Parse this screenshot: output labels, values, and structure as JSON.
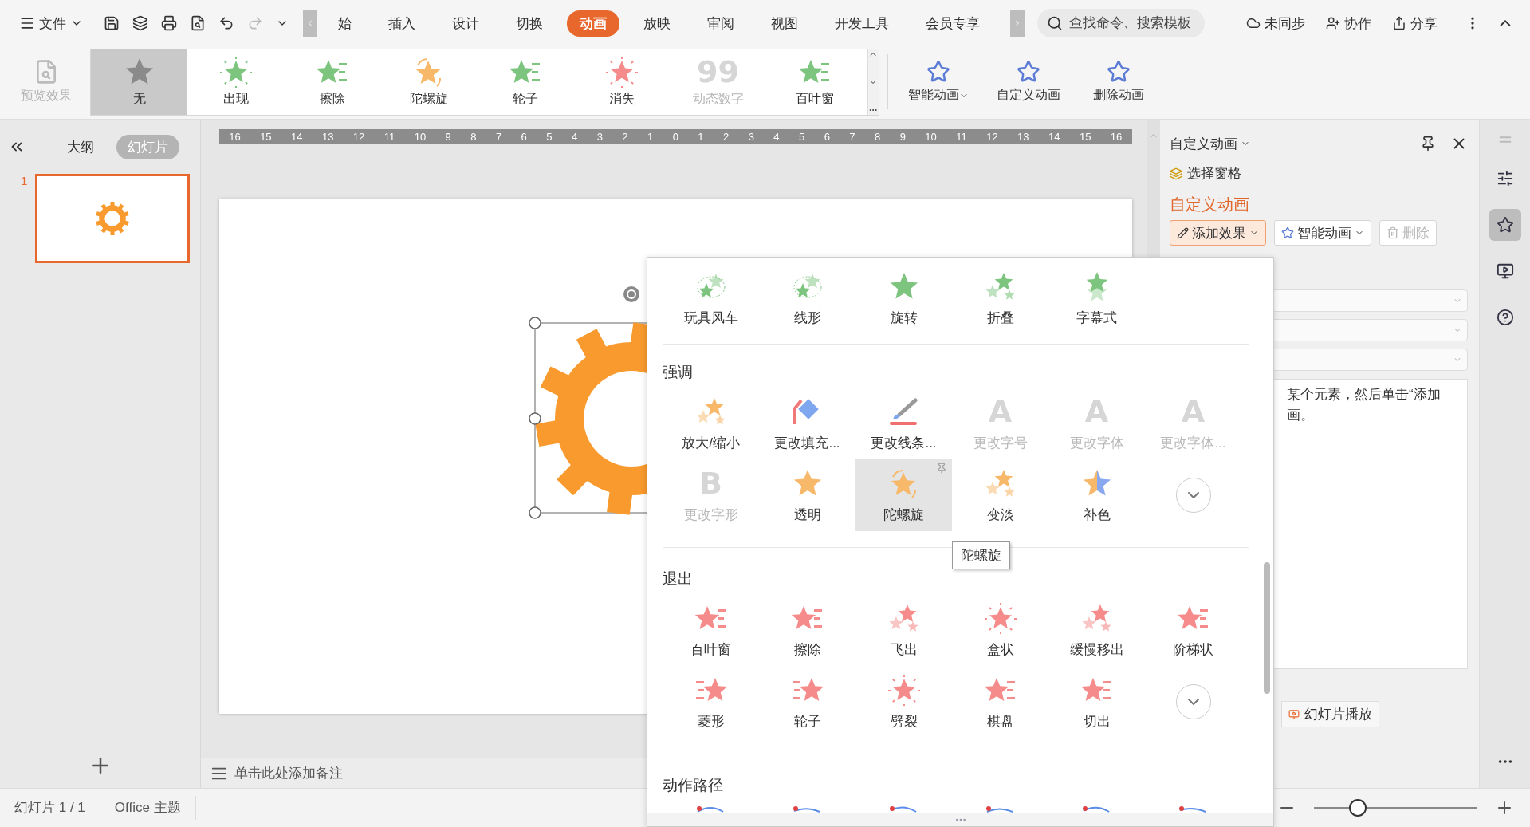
{
  "menu_bar": {
    "file_menu": "文件",
    "tabs": [
      {
        "label": "始",
        "selected": false
      },
      {
        "label": "插入",
        "selected": false
      },
      {
        "label": "设计",
        "selected": false
      },
      {
        "label": "切换",
        "selected": false
      },
      {
        "label": "动画",
        "selected": true
      },
      {
        "label": "放映",
        "selected": false
      },
      {
        "label": "审阅",
        "selected": false
      },
      {
        "label": "视图",
        "selected": false
      },
      {
        "label": "开发工具",
        "selected": false
      },
      {
        "label": "会员专享",
        "selected": false
      }
    ],
    "search": {
      "placeholder": "查找命令、搜索模板"
    },
    "actions": [
      "未同步",
      "协作",
      "分享"
    ]
  },
  "ribbon": {
    "preview": {
      "label": "预览效果",
      "disabled": true
    },
    "gallery": [
      {
        "label": "无",
        "kind": "star",
        "color": "#8a8a8a",
        "selected": true,
        "disabled": false
      },
      {
        "label": "出现",
        "kind": "burst",
        "color": "#7dc47f",
        "selected": false,
        "disabled": false
      },
      {
        "label": "擦除",
        "kind": "lines",
        "color": "#7dc47f",
        "selected": false,
        "disabled": false
      },
      {
        "label": "陀螺旋",
        "kind": "spin",
        "color": "#f8b86a",
        "selected": false,
        "disabled": false
      },
      {
        "label": "轮子",
        "kind": "lines",
        "color": "#7dc47f",
        "selected": false,
        "disabled": false
      },
      {
        "label": "消失",
        "kind": "burst",
        "color": "#f58b8b",
        "selected": false,
        "disabled": false
      },
      {
        "label": "动态数字",
        "kind": "letter",
        "glyph": "99",
        "color": "#d6d6d6",
        "selected": false,
        "disabled": true
      },
      {
        "label": "百叶窗",
        "kind": "lines",
        "color": "#7dc47f",
        "selected": false,
        "disabled": false
      }
    ],
    "buttons": [
      {
        "label": "智能动画",
        "dropdown": true
      },
      {
        "label": "自定义动画"
      },
      {
        "label": "删除动画"
      }
    ]
  },
  "ruler": {
    "labels": [
      "16",
      "15",
      "14",
      "13",
      "12",
      "11",
      "10",
      "9",
      "8",
      "7",
      "6",
      "5",
      "4",
      "3",
      "2",
      "1",
      "0",
      "1",
      "2",
      "3",
      "4",
      "5",
      "6",
      "7",
      "8",
      "9",
      "10",
      "11",
      "12",
      "13",
      "14",
      "15",
      "16"
    ]
  },
  "outline_panel": {
    "tabs": [
      {
        "label": "大纲",
        "selected": false
      },
      {
        "label": "幻灯片",
        "selected": true
      }
    ],
    "slides": [
      {
        "number": "1",
        "selected": true
      }
    ]
  },
  "notes": {
    "placeholder": "单击此处添加备注"
  },
  "task_pane": {
    "title": "自定义动画",
    "selection_pane": "选择窗格",
    "heading": "自定义动画",
    "buttons": [
      {
        "label": "添加效果",
        "dropdown": true,
        "active": true,
        "disabled": false
      },
      {
        "label": "智能动画",
        "dropdown": true,
        "active": false,
        "disabled": false
      },
      {
        "label": "删除",
        "active": false,
        "disabled": true
      }
    ],
    "hint_lines": [
      "某个元素，然后单击“添加",
      "画。"
    ],
    "play_button": "幻灯片播放"
  },
  "status_bar": {
    "items": [
      "幻灯片 1 / 1",
      "Office 主题"
    ],
    "zoom": {
      "level": 0.27
    }
  },
  "effects_menu": {
    "tooltip": "陀螺旋",
    "sections": [
      {
        "kind": "grid",
        "items": [
          {
            "label": "玩具风车",
            "kind": "orbit",
            "color": "#7dc47f",
            "selected": false,
            "disabled": false
          },
          {
            "label": "线形",
            "kind": "orbit",
            "color": "#7dc47f",
            "selected": false,
            "disabled": false
          },
          {
            "label": "旋转",
            "kind": "star",
            "color": "#7dc47f",
            "selected": false,
            "disabled": false
          },
          {
            "label": "折叠",
            "kind": "pair",
            "color": "#7dc47f",
            "selected": false,
            "disabled": false
          },
          {
            "label": "字幕式",
            "kind": "stack",
            "color": "#7dc47f",
            "selected": false,
            "disabled": false
          }
        ]
      },
      {
        "kind": "grid",
        "title": "强调",
        "more": true,
        "items": [
          {
            "label": "放大/缩小",
            "kind": "pair",
            "color": "#f8b86a",
            "selected": false,
            "disabled": false
          },
          {
            "label": "更改填充...",
            "kind": "fill",
            "color": "#7fa7ef",
            "selected": false,
            "disabled": false
          },
          {
            "label": "更改线条...",
            "kind": "pen",
            "color": "#f07070",
            "selected": false,
            "disabled": false
          },
          {
            "label": "更改字号",
            "kind": "letter",
            "glyph": "A",
            "color": "#d6d6d6",
            "selected": false,
            "disabled": true
          },
          {
            "label": "更改字体",
            "kind": "letter",
            "glyph": "A",
            "color": "#d6d6d6",
            "selected": false,
            "disabled": true
          },
          {
            "label": "更改字体...",
            "kind": "letter",
            "glyph": "A",
            "color": "#d6d6d6",
            "selected": false,
            "disabled": true
          },
          {
            "label": "更改字形",
            "kind": "letter",
            "glyph": "B",
            "color": "#d6d6d6",
            "selected": false,
            "disabled": true
          },
          {
            "label": "透明",
            "kind": "star",
            "color": "#f8b86a",
            "selected": false,
            "disabled": false
          },
          {
            "label": "陀螺旋",
            "kind": "spin",
            "color": "#f8b86a",
            "selected": true,
            "disabled": false
          },
          {
            "label": "变淡",
            "kind": "pair",
            "color": "#f8b86a",
            "selected": false,
            "disabled": false
          },
          {
            "label": "补色",
            "kind": "bicolor",
            "color": "#f8b86a",
            "selected": false,
            "disabled": false
          }
        ]
      },
      {
        "kind": "grid",
        "title": "退出",
        "more": true,
        "items": [
          {
            "label": "百叶窗",
            "kind": "lines",
            "color": "#f58b8b",
            "selected": false,
            "disabled": false
          },
          {
            "label": "擦除",
            "kind": "lines",
            "color": "#f58b8b",
            "selected": false,
            "disabled": false
          },
          {
            "label": "飞出",
            "kind": "pair",
            "color": "#f58b8b",
            "selected": false,
            "disabled": false
          },
          {
            "label": "盒状",
            "kind": "burst",
            "color": "#f58b8b",
            "selected": false,
            "disabled": false
          },
          {
            "label": "缓慢移出",
            "kind": "pair",
            "color": "#f58b8b",
            "selected": false,
            "disabled": false
          },
          {
            "label": "阶梯状",
            "kind": "lines",
            "color": "#f58b8b",
            "selected": false,
            "disabled": false
          },
          {
            "label": "菱形",
            "kind": "lines-left",
            "color": "#f58b8b",
            "selected": false,
            "disabled": false
          },
          {
            "label": "轮子",
            "kind": "lines-left",
            "color": "#f58b8b",
            "selected": false,
            "disabled": false
          },
          {
            "label": "劈裂",
            "kind": "burst",
            "color": "#f58b8b",
            "selected": false,
            "disabled": false
          },
          {
            "label": "棋盘",
            "kind": "lines",
            "color": "#f58b8b",
            "selected": false,
            "disabled": false
          },
          {
            "label": "切出",
            "kind": "lines",
            "color": "#f58b8b",
            "selected": false,
            "disabled": false
          }
        ]
      },
      {
        "kind": "paths",
        "title": "动作路径"
      }
    ]
  }
}
